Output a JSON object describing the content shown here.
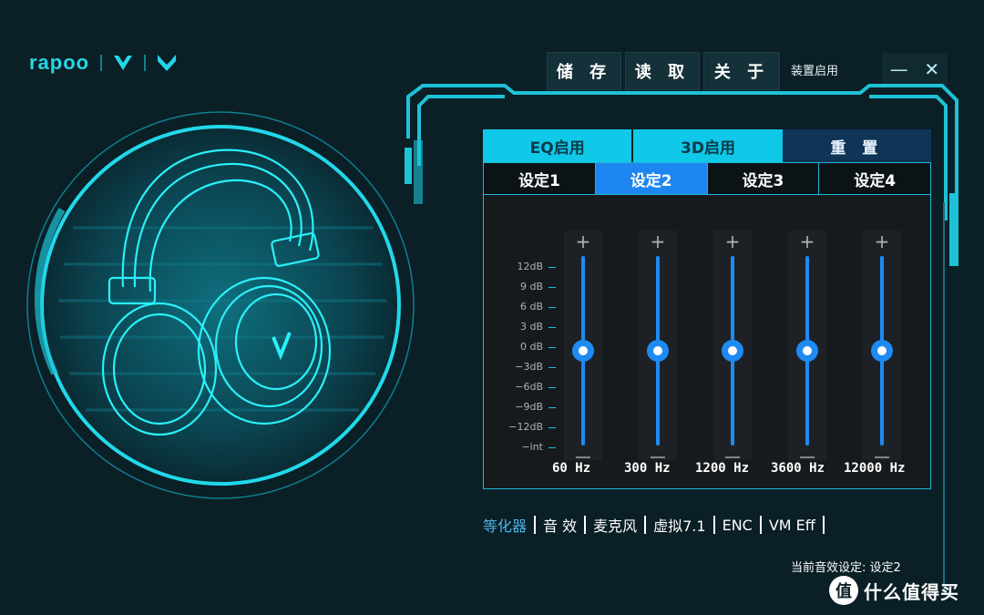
{
  "brand": {
    "name": "rapoo"
  },
  "toolbar": {
    "save": "储 存",
    "load": "读 取",
    "about": "关 于",
    "device_status": "装置启用"
  },
  "window": {
    "minimize": "—",
    "close": "✕"
  },
  "modes": {
    "eq": "EQ启用",
    "three_d": "3D启用",
    "reset": "重 置"
  },
  "presets": [
    {
      "label": "设定1"
    },
    {
      "label": "设定2",
      "active": true
    },
    {
      "label": "设定3"
    },
    {
      "label": "设定4"
    }
  ],
  "eq": {
    "db_scale": [
      "12dB",
      "9 dB",
      "6 dB",
      "3 dB",
      "0 dB",
      "−3dB",
      "−6dB",
      "−9dB",
      "−12dB",
      "−int"
    ],
    "bands": [
      {
        "label": "60 Hz",
        "gain_db": 0
      },
      {
        "label": "300 Hz",
        "gain_db": 0
      },
      {
        "label": "1200 Hz",
        "gain_db": 0
      },
      {
        "label": "3600 Hz",
        "gain_db": 0
      },
      {
        "label": "12000 Hz",
        "gain_db": 0
      }
    ],
    "plus": "+"
  },
  "nav": {
    "items": [
      "等化器",
      "音 效",
      "麦克风",
      "虚拟7.1",
      "ENC",
      "VM Eff"
    ],
    "active_index": 0
  },
  "status": {
    "current": "当前音效设定: 设定2"
  },
  "watermark": {
    "badge": "值",
    "text": "什么值得买"
  },
  "colors": {
    "accent": "#10c8e8",
    "active_preset": "#1e86f0",
    "background": "#0a1f26"
  }
}
